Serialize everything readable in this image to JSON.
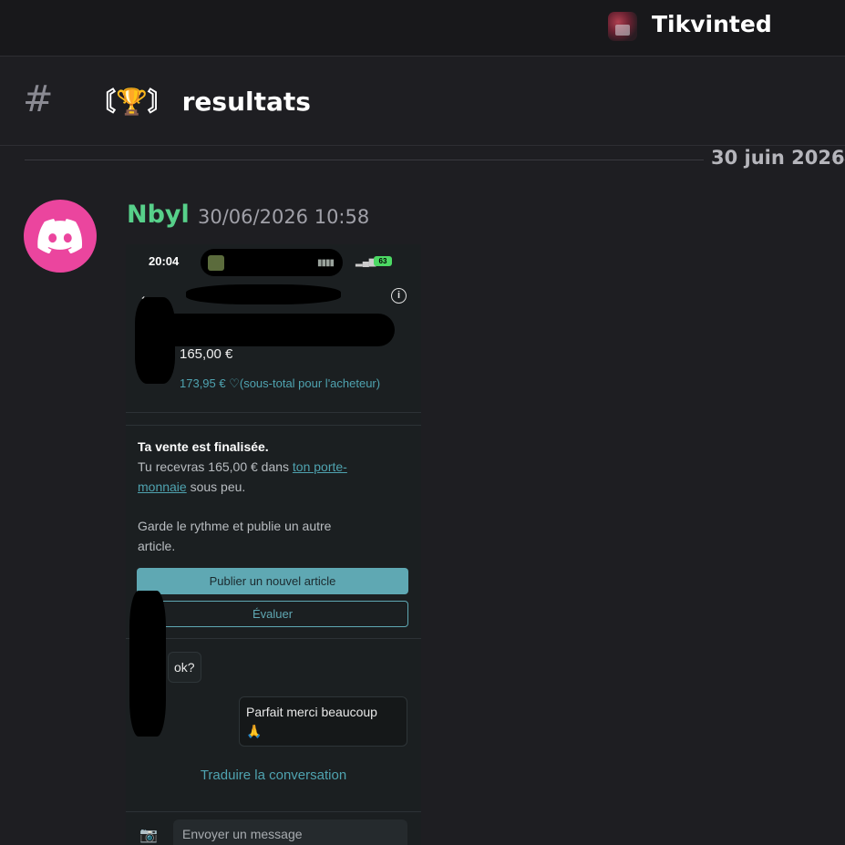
{
  "server": {
    "name": "Tikvinted"
  },
  "channel": {
    "hash": "#",
    "name": "〘🏆〙 resultats"
  },
  "divider": {
    "date": "30 juin 2026"
  },
  "message": {
    "author": "Nbyl",
    "timestamp": "30/06/2026 10:58",
    "avatar_color": "#eb459e",
    "author_color": "#57d08a"
  },
  "screenshot": {
    "status_time": "20:04",
    "battery": "63",
    "price": "165,00 €",
    "subtotal": "173,95 € ♡(sous-total pour l'acheteur)",
    "sale_title": "Ta vente est finalisée.",
    "sale_line1": "Tu recevras 165,00 € dans ",
    "sale_link1": "ton porte-",
    "sale_link2": "monnaie",
    "sale_line2": " sous peu.",
    "keep_line1": "Garde le rythme et publie un autre",
    "keep_line2": "article.",
    "btn_publish": "Publier un nouvel article",
    "btn_rate": "Évaluer",
    "msg_them": "ok?",
    "msg_me_line1": "Parfait merci beaucoup",
    "msg_me_line2": "🙏",
    "translate": "Traduire la conversation",
    "input_placeholder": "Envoyer un message",
    "accent": "#5fa8b3"
  }
}
